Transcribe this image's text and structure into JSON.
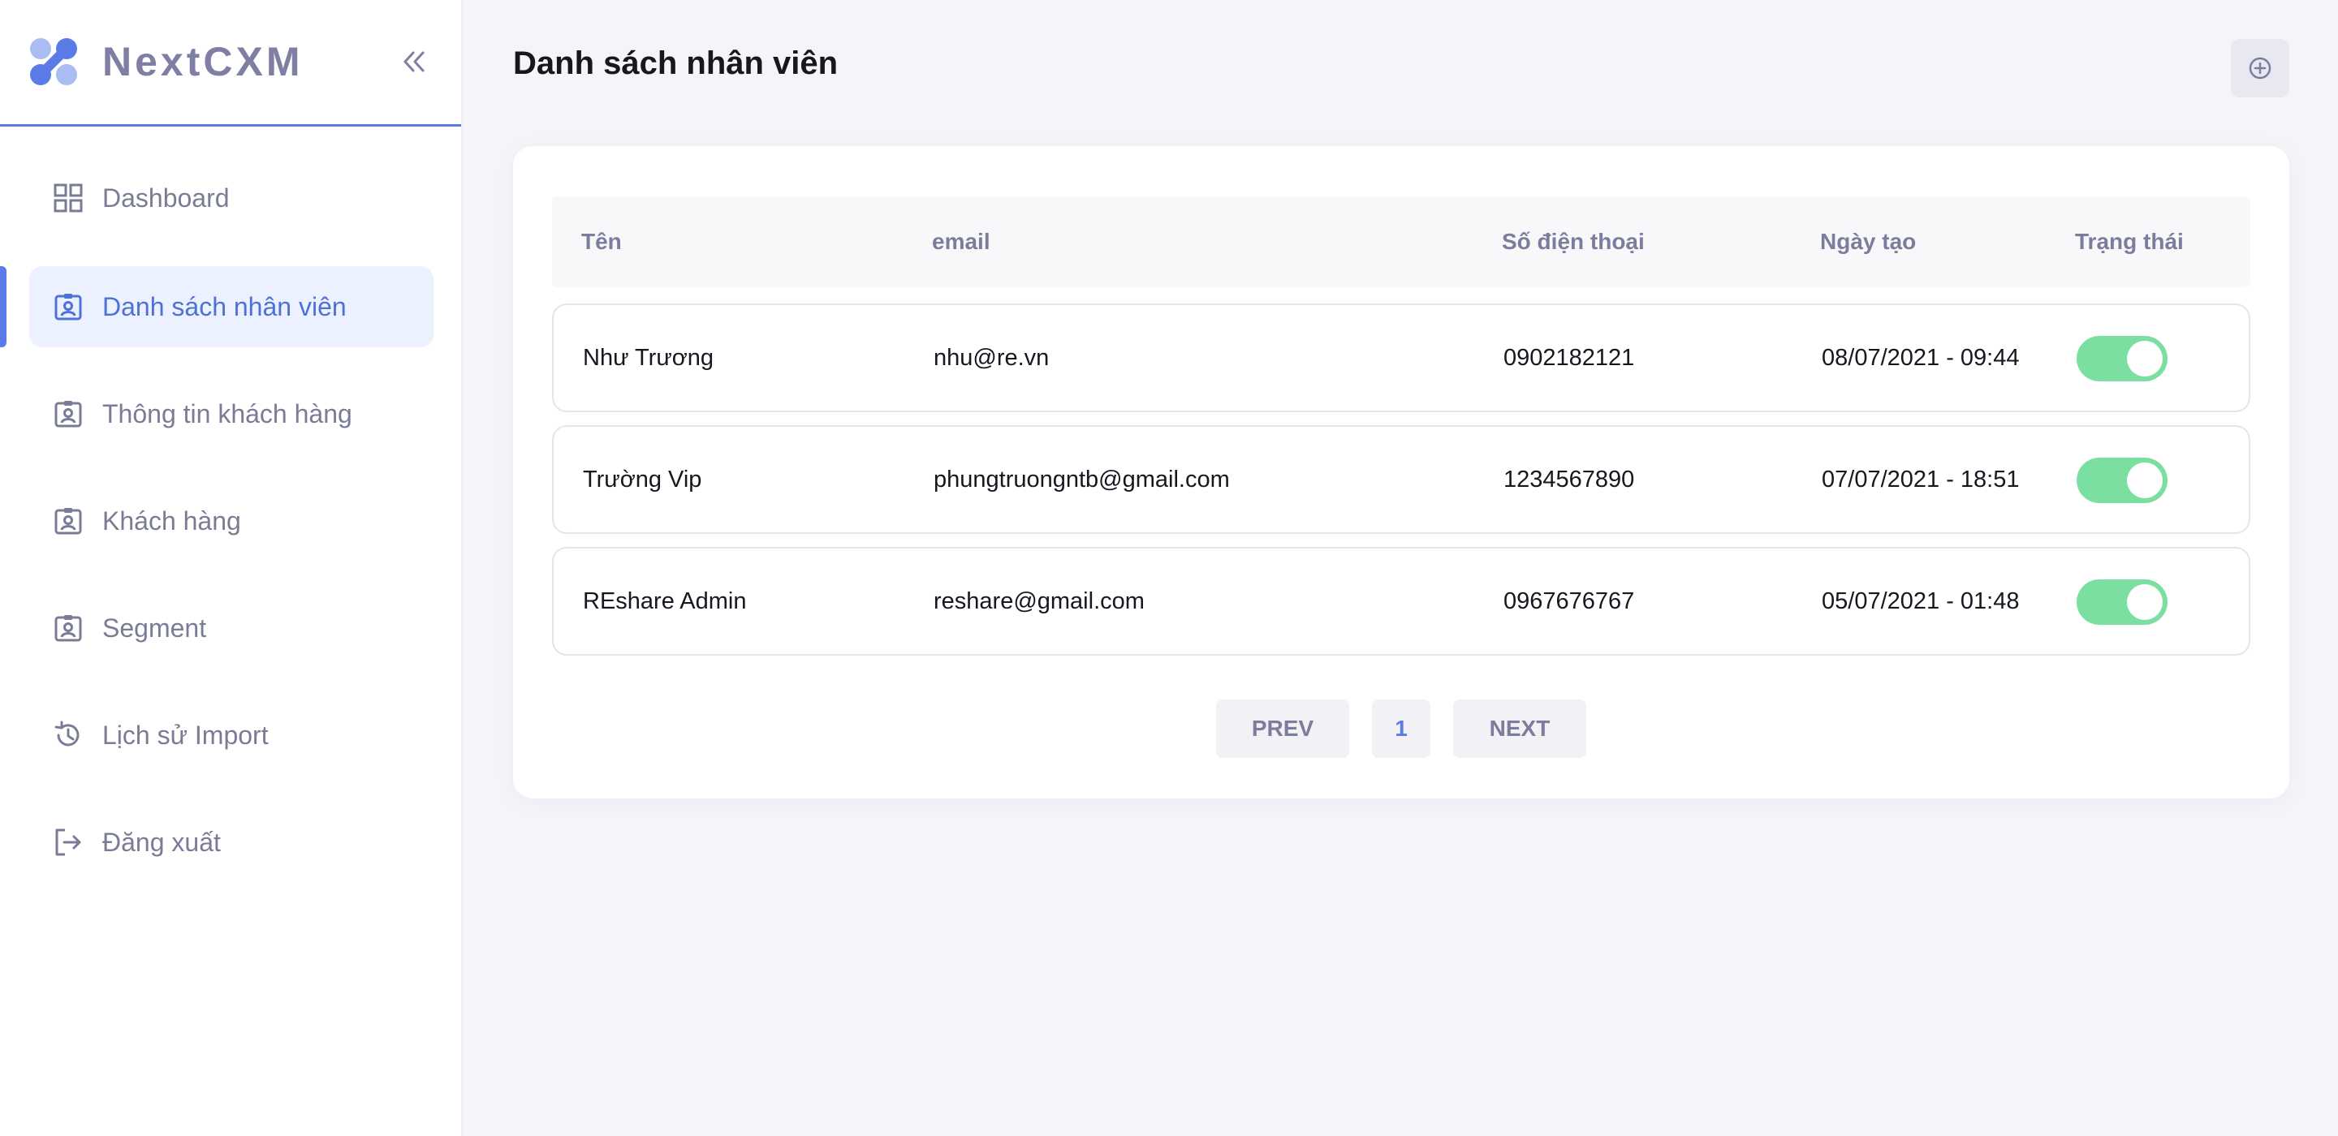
{
  "app": {
    "brand_name": "NextCXM",
    "accent_color": "#5b7be6",
    "toggle_on_color": "#7bdfa1"
  },
  "sidebar": {
    "collapse_icon": "double-chevron-left-icon",
    "items": [
      {
        "label": "Dashboard",
        "icon": "grid-icon",
        "active": false
      },
      {
        "label": "Danh sách nhân viên",
        "icon": "id-badge-icon",
        "active": true
      },
      {
        "label": "Thông tin khách hàng",
        "icon": "id-badge-icon",
        "active": false
      },
      {
        "label": "Khách hàng",
        "icon": "id-badge-icon",
        "active": false
      },
      {
        "label": "Segment",
        "icon": "id-badge-icon",
        "active": false
      },
      {
        "label": "Lịch sử Import",
        "icon": "history-icon",
        "active": false
      },
      {
        "label": "Đăng xuất",
        "icon": "logout-icon",
        "active": false
      }
    ]
  },
  "header": {
    "title": "Danh sách nhân viên",
    "add_icon": "plus-circle-icon"
  },
  "table": {
    "columns": [
      "Tên",
      "email",
      "Số điện thoại",
      "Ngày tạo",
      "Trạng thái"
    ],
    "rows": [
      {
        "name": "Như Trương",
        "email": "nhu@re.vn",
        "phone": "0902182121",
        "created": "08/07/2021 - 09:44",
        "status_on": true
      },
      {
        "name": "Trường Vip",
        "email": "phungtruongntb@gmail.com",
        "phone": "1234567890",
        "created": "07/07/2021 - 18:51",
        "status_on": true
      },
      {
        "name": "REshare Admin",
        "email": "reshare@gmail.com",
        "phone": "0967676767",
        "created": "05/07/2021 - 01:48",
        "status_on": true
      }
    ]
  },
  "pagination": {
    "prev_label": "PREV",
    "current_page": "1",
    "next_label": "NEXT"
  }
}
